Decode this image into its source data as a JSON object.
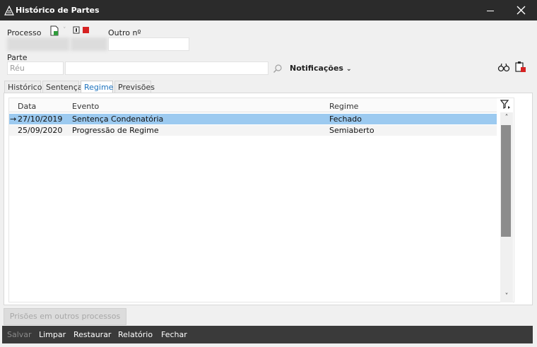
{
  "window": {
    "title": "Histórico de Partes"
  },
  "form": {
    "processo_label": "Processo",
    "outro_label": "Outro nº",
    "outro_value": "",
    "parte_label": "Parte",
    "parte_type_placeholder": "Réu",
    "parte_name_value": "",
    "notificacoes_label": "Notificações"
  },
  "tabs": [
    {
      "label": "Histórico",
      "active": false
    },
    {
      "label": "Sentença",
      "active": false
    },
    {
      "label": "Regime",
      "active": true
    },
    {
      "label": "Previsões",
      "active": false
    }
  ],
  "grid": {
    "columns": [
      "Data",
      "Evento",
      "Regime"
    ],
    "rows": [
      {
        "data": "27/10/2019",
        "evento": "Sentença Condenatória",
        "regime": "Fechado",
        "selected": true
      },
      {
        "data": "25/09/2020",
        "evento": "Progressão de Regime",
        "regime": "Semiaberto",
        "selected": false
      }
    ],
    "current_row_marker": "→"
  },
  "buttons": {
    "outros": "Prisões em outros processos",
    "salvar": "Salvar",
    "limpar": "Limpar",
    "restaurar": "Restaurar",
    "relatorio": "Relatório",
    "fechar": "Fechar"
  },
  "colors": {
    "titlebar": "#2b2b2b",
    "selection": "#9ccaf0",
    "accent": "#1e73be",
    "bottombar": "#3a3a3a"
  }
}
